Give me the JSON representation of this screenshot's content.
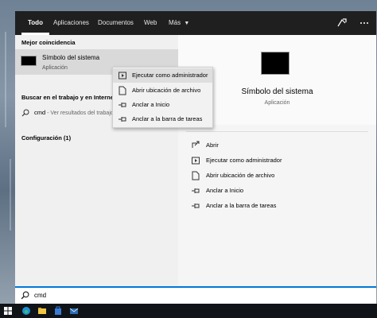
{
  "tabs": [
    {
      "label": "Todo",
      "active": true
    },
    {
      "label": "Aplicaciones",
      "active": false
    },
    {
      "label": "Documentos",
      "active": false
    },
    {
      "label": "Web",
      "active": false
    },
    {
      "label": "Más",
      "active": false
    }
  ],
  "left": {
    "best_match_header": "Mejor coincidencia",
    "best_match": {
      "title": "Símbolo del sistema",
      "subtitle": "Aplicación"
    },
    "web_header": "Buscar en el trabajo y en Internet",
    "web_result": {
      "query": "cmd",
      "hint": " - Ver resultados del trabajo e Internet"
    },
    "settings_header": "Configuración (1)"
  },
  "context_menu": [
    {
      "label": "Ejecutar como administrador",
      "icon": "shield-run-icon"
    },
    {
      "label": "Abrir ubicación de archivo",
      "icon": "file-location-icon"
    },
    {
      "label": "Anclar a Inicio",
      "icon": "pin-icon"
    },
    {
      "label": "Anclar a la barra de tareas",
      "icon": "pin-icon"
    }
  ],
  "right": {
    "title": "Símbolo del sistema",
    "subtitle": "Aplicación",
    "actions": [
      {
        "label": "Abrir",
        "icon": "open-icon"
      },
      {
        "label": "Ejecutar como administrador",
        "icon": "shield-run-icon"
      },
      {
        "label": "Abrir ubicación de archivo",
        "icon": "file-location-icon"
      },
      {
        "label": "Anclar a Inicio",
        "icon": "pin-icon"
      },
      {
        "label": "Anclar a la barra de tareas",
        "icon": "pin-icon"
      }
    ]
  },
  "search": {
    "value": "cmd"
  },
  "colors": {
    "accent": "#0078d7",
    "topbar": "#1f1f1f",
    "selected": "#d9d9d9"
  }
}
